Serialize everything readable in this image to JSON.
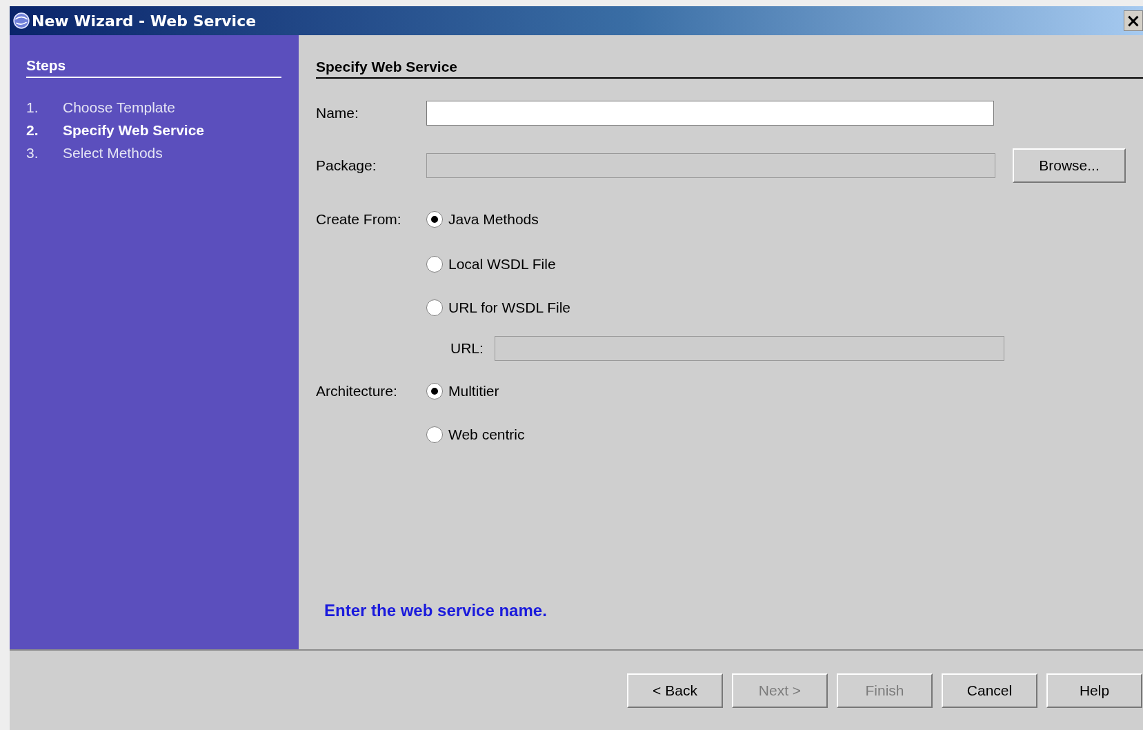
{
  "window": {
    "title": "New Wizard - Web Service",
    "close": "×"
  },
  "steps": {
    "heading": "Steps",
    "items": [
      {
        "number": "1.",
        "label": "Choose Template",
        "selected": false
      },
      {
        "number": "2.",
        "label": "Specify Web Service",
        "selected": true
      },
      {
        "number": "3.",
        "label": "Select Methods",
        "selected": false
      }
    ]
  },
  "panel": {
    "heading": "Specify Web Service",
    "name_field": {
      "label": "Name:",
      "disabled": false
    },
    "package_field": {
      "label": "Package:",
      "disabled": true
    },
    "browse_button": {
      "label": "Browse...",
      "disabled": false
    },
    "create_from": {
      "label": "Create From:",
      "options": [
        {
          "label": "Java Methods",
          "selected": true
        },
        {
          "label": "Local WSDL File",
          "selected": false
        },
        {
          "label": "URL for WSDL File",
          "selected": false
        }
      ]
    },
    "url_field": {
      "label": "URL:",
      "disabled": true
    },
    "architecture": {
      "label": "Architecture:",
      "options": [
        {
          "label": "Multitier",
          "selected": true
        },
        {
          "label": "Web centric",
          "selected": false
        }
      ]
    },
    "message": "Enter the web service name."
  },
  "buttons": [
    {
      "label": "< Back",
      "disabled": false
    },
    {
      "label": "Next >",
      "disabled": true
    },
    {
      "label": "Finish",
      "disabled": true
    },
    {
      "label": "Cancel",
      "disabled": false
    },
    {
      "label": "Help",
      "disabled": false
    }
  ]
}
